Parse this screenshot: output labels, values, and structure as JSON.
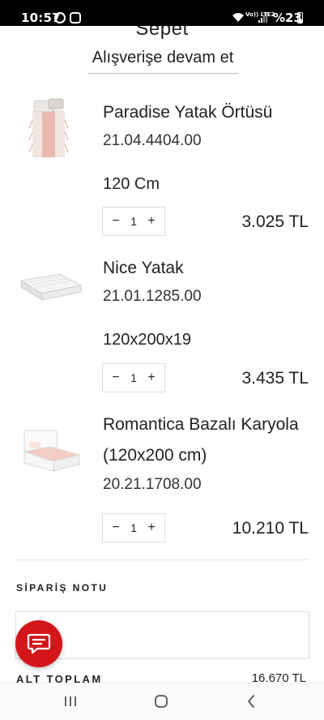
{
  "status_bar": {
    "time": "10:57",
    "volte": "Vo)) LTE2",
    "battery": "%23"
  },
  "header": {
    "title": "Sepet",
    "continue_link": "Alışverişe devam et"
  },
  "items": [
    {
      "name": "Paradise Yatak Örtüsü",
      "sku": "21.04.4404.00",
      "variant": "120 Cm",
      "quantity": "1",
      "price": "3.025 TL",
      "thumb_icon": "bedspread-image"
    },
    {
      "name": "Nice Yatak",
      "sku": "21.01.1285.00",
      "variant": "120x200x19",
      "quantity": "1",
      "price": "3.435 TL",
      "thumb_icon": "mattress-image"
    },
    {
      "name_line1": "Romantica Bazalı Karyola",
      "name_line2": "(120x200 cm)",
      "sku": "20.21.1708.00",
      "quantity": "1",
      "price": "10.210 TL",
      "thumb_icon": "bed-frame-image"
    }
  ],
  "qty_controls": {
    "minus": "−",
    "plus": "+"
  },
  "order_note": {
    "label": "SİPARİŞ NOTU",
    "placeholder": ""
  },
  "subtotal": {
    "label": "ALT TOPLAM",
    "value": "16.670 TL"
  },
  "colors": {
    "accent": "#d4161b",
    "text": "#222222",
    "border": "#dddddd"
  }
}
